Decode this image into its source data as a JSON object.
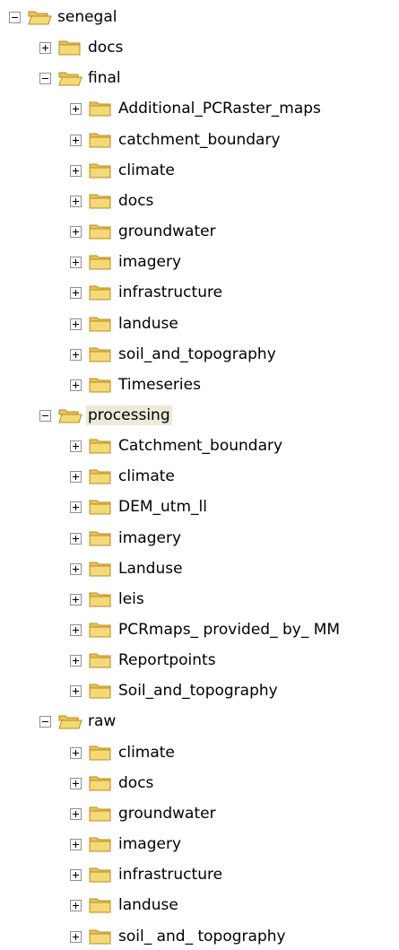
{
  "tree": {
    "label": "senegal",
    "expanded": true,
    "children": [
      {
        "label": "docs",
        "expanded": false
      },
      {
        "label": "final",
        "expanded": true,
        "children": [
          {
            "label": "Additional_PCRaster_maps",
            "expanded": false
          },
          {
            "label": "catchment_boundary",
            "expanded": false
          },
          {
            "label": "climate",
            "expanded": false
          },
          {
            "label": "docs",
            "expanded": false
          },
          {
            "label": "groundwater",
            "expanded": false
          },
          {
            "label": "imagery",
            "expanded": false
          },
          {
            "label": "infrastructure",
            "expanded": false
          },
          {
            "label": "landuse",
            "expanded": false
          },
          {
            "label": "soil_and_topography",
            "expanded": false
          },
          {
            "label": "Timeseries",
            "expanded": false
          }
        ]
      },
      {
        "label": "processing",
        "expanded": true,
        "selected": true,
        "children": [
          {
            "label": "Catchment_boundary",
            "expanded": false
          },
          {
            "label": "climate",
            "expanded": false
          },
          {
            "label": "DEM_utm_ll",
            "expanded": false
          },
          {
            "label": "imagery",
            "expanded": false
          },
          {
            "label": "Landuse",
            "expanded": false
          },
          {
            "label": "leis",
            "expanded": false
          },
          {
            "label": "PCRmaps_ provided_ by_ MM",
            "expanded": false
          },
          {
            "label": "Reportpoints",
            "expanded": false
          },
          {
            "label": "Soil_and_topography",
            "expanded": false
          }
        ]
      },
      {
        "label": "raw",
        "expanded": true,
        "children": [
          {
            "label": "climate",
            "expanded": false
          },
          {
            "label": "docs",
            "expanded": false
          },
          {
            "label": "groundwater",
            "expanded": false
          },
          {
            "label": "imagery",
            "expanded": false
          },
          {
            "label": "infrastructure",
            "expanded": false
          },
          {
            "label": "landuse",
            "expanded": false
          },
          {
            "label": "soil_ and_ topography",
            "expanded": false
          }
        ]
      }
    ]
  },
  "colors": {
    "folder_fill": "#f5d977",
    "folder_tab": "#e9c45a",
    "folder_outline": "#b58d1e",
    "selection": "#ece9d8"
  }
}
